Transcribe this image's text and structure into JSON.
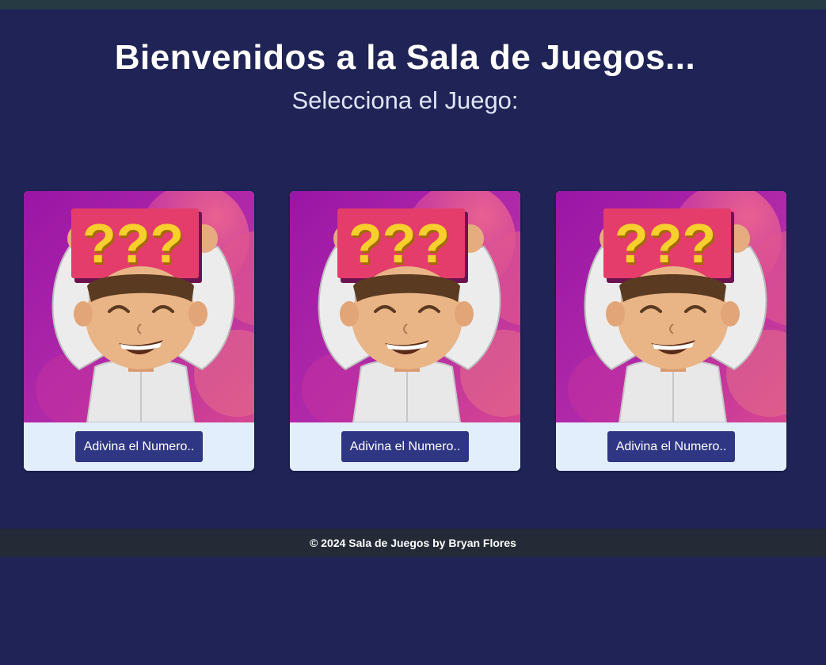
{
  "header": {
    "title": "Bienvenidos a la Sala de Juegos...",
    "subtitle": "Selecciona el Juego:"
  },
  "games": [
    {
      "button_label": "Adivina el Numero..",
      "image_text": "???",
      "image_icon": "guess-number-character-icon"
    },
    {
      "button_label": "Adivina el Numero..",
      "image_text": "???",
      "image_icon": "guess-number-character-icon"
    },
    {
      "button_label": "Adivina el Numero..",
      "image_text": "???",
      "image_icon": "guess-number-character-icon"
    }
  ],
  "footer": {
    "text": "© 2024 Sala de Juegos by Bryan Flores"
  },
  "colors": {
    "background": "#1f2355",
    "topbar": "#263a44",
    "footer_bg": "#242a36",
    "card_footer": "#e3eefc",
    "button": "#2f3683",
    "sign": "#e43d6b",
    "question_marks": "#f8cf2c"
  }
}
